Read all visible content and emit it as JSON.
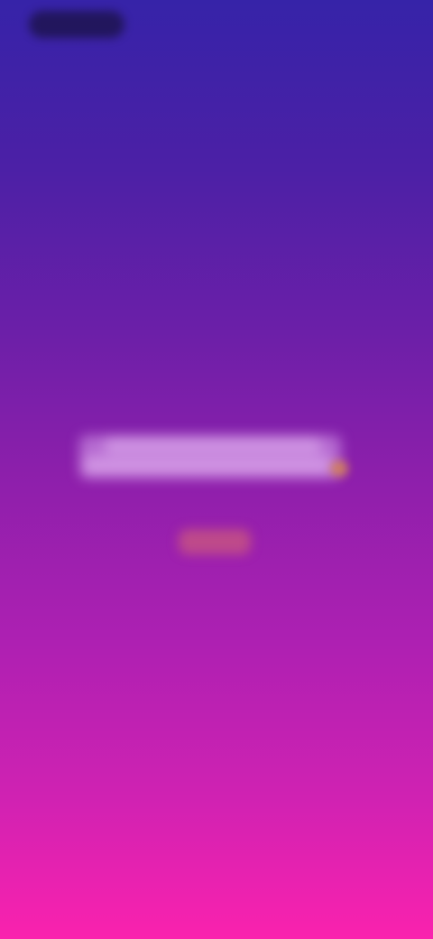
{
  "screen": {
    "gradient_top": "#3623a8",
    "gradient_bottom": "#fa22ae"
  },
  "header": {
    "logo_icon": "app-logo-icon"
  },
  "content": {
    "title": "",
    "cta_label": "",
    "accent_color": "#d98a4a"
  }
}
